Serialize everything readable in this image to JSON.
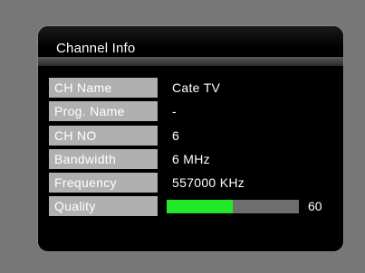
{
  "panel": {
    "title": "Channel Info"
  },
  "rows": [
    {
      "label": "CH Name",
      "value": "Cate TV"
    },
    {
      "label": "Prog. Name",
      "value": "-"
    },
    {
      "label": "CH NO",
      "value": "6"
    },
    {
      "label": "Bandwidth",
      "value": "6 MHz"
    },
    {
      "label": "Frequency",
      "value": "557000 KHz"
    }
  ],
  "quality": {
    "label": "Quality",
    "value": "60",
    "level_percent": 50,
    "fill_color": "#22e82a",
    "track_color": "#6e6e6e"
  },
  "colors": {
    "background": "#777777",
    "panel": "#000000",
    "label_bg": "#b0b0b0",
    "text": "#ffffff"
  }
}
